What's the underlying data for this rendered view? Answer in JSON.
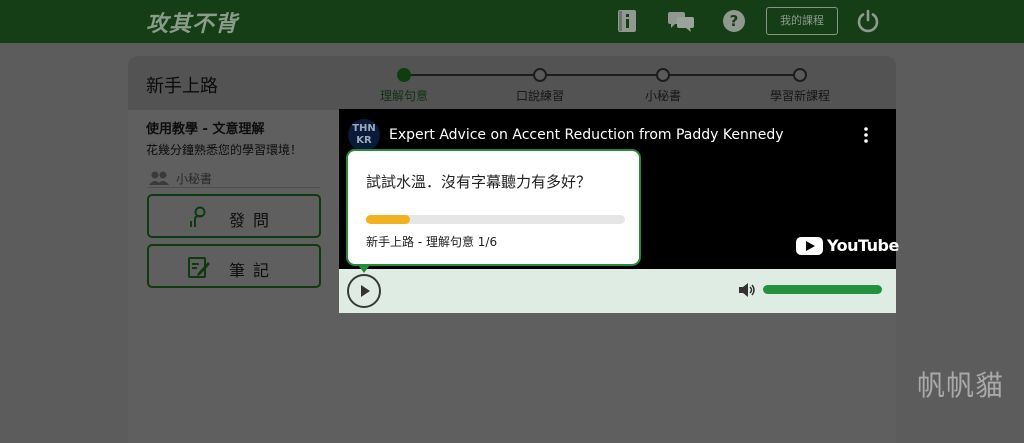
{
  "header": {
    "logo_text": "攻其不背",
    "icons": [
      "book-info-icon",
      "chat-icon",
      "help-icon",
      "power-icon"
    ],
    "course_button": "我的課程",
    "bar_color": "#163e16"
  },
  "panel": {
    "title": "新手上路",
    "steps": [
      {
        "label": "理解句意",
        "active": true
      },
      {
        "label": "口說練習",
        "active": false
      },
      {
        "label": "小秘書",
        "active": false
      },
      {
        "label": "學習新課程",
        "active": false
      }
    ]
  },
  "sidebar": {
    "section_title": "使用教學 - 文意理解",
    "section_sub": "花幾分鐘熟悉您的學習環境！",
    "helper_label": "小秘書",
    "ask_button": "發問",
    "notes_button": "筆記"
  },
  "video": {
    "channel_logo": "THN KR",
    "title": "Expert Advice on Accent Reduction from Paddy Kennedy",
    "brand": "YouTube",
    "volume_level": 1.0
  },
  "tooltip": {
    "question": "試試水溫．沒有字幕聽力有多好？",
    "progress": 0.17,
    "caption": "新手上路 - 理解句意 1/6",
    "accent_color": "#2a8a3c",
    "progress_color": "#f2b120"
  },
  "watermark": "帆帆貓"
}
